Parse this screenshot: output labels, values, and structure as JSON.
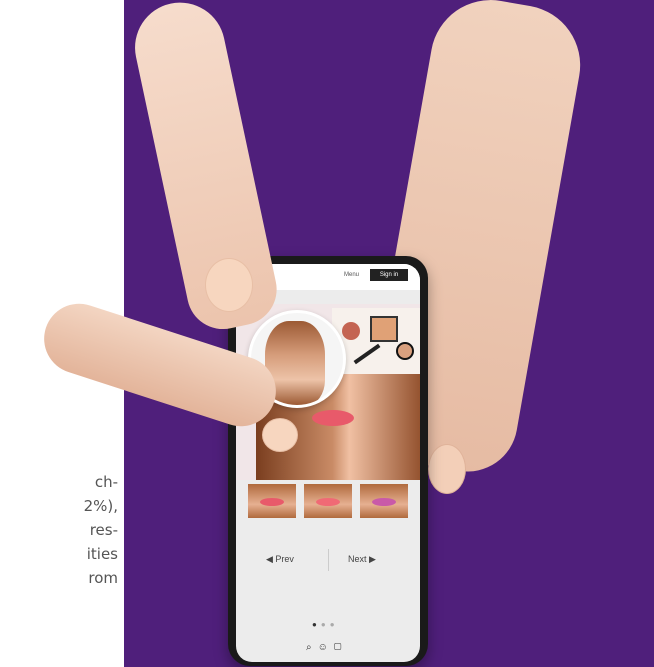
{
  "side_text": [
    "ch-",
    "2%),",
    "res-",
    "ities",
    "rom"
  ],
  "app": {
    "menu_label": "Menu",
    "signin_label": "Sign in",
    "share_icon": "share-icon",
    "prev_label": "Prev",
    "next_label": "Next",
    "bottom_icons": [
      "search-icon",
      "user-icon",
      "bag-icon"
    ]
  },
  "colors": {
    "background_accent": "#4f1f7b",
    "lip_shades": [
      "#e85a6a",
      "#f06a75",
      "#c95aa8"
    ]
  },
  "carousel": {
    "current_page": 1,
    "total_pages": 3
  }
}
